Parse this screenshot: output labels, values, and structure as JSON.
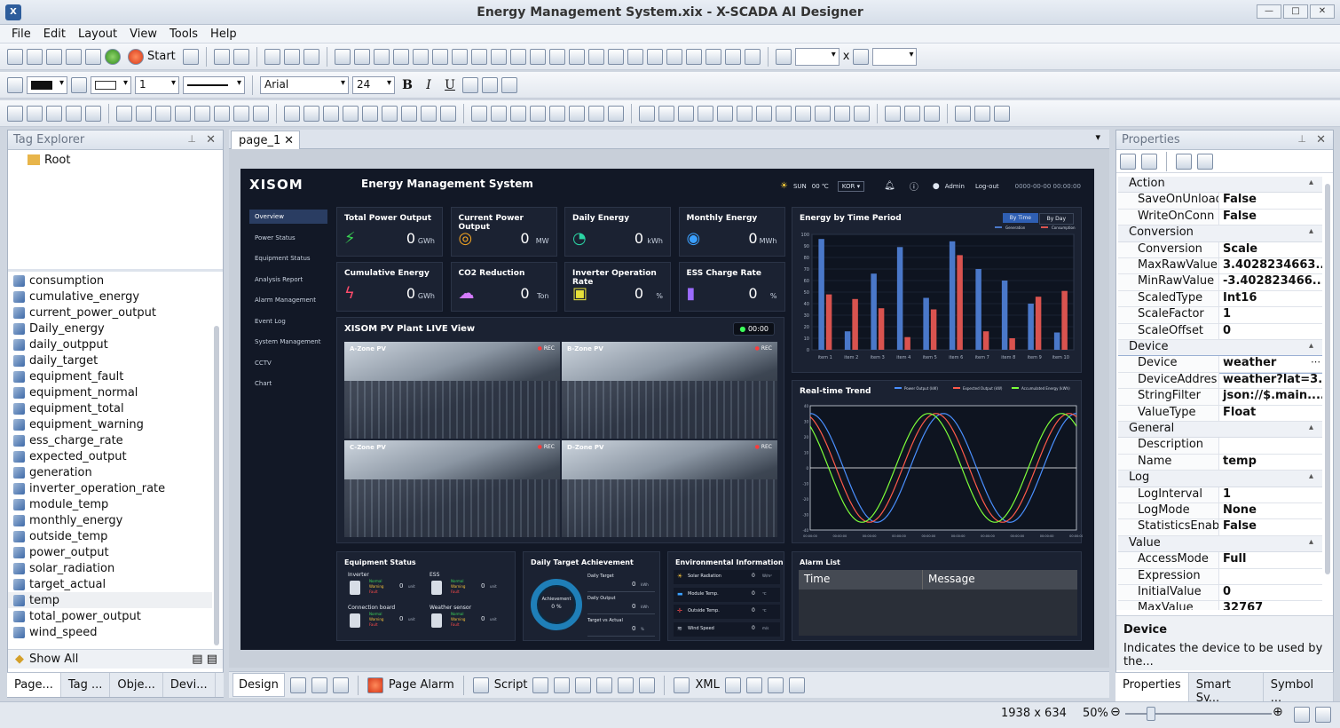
{
  "window": {
    "title": "Energy Management System.xix - X-SCADA AI Designer"
  },
  "menu": [
    "File",
    "Edit",
    "Layout",
    "View",
    "Tools",
    "Help"
  ],
  "toolbar": {
    "start_label": "Start",
    "font_name": "Arial",
    "font_size": "24",
    "line_width": "1",
    "size_sep": "x"
  },
  "tag_explorer": {
    "title": "Tag Explorer",
    "root": "Root",
    "tags": [
      "consumption",
      "cumulative_energy",
      "current_power_output",
      "Daily_energy",
      "daily_outpput",
      "daily_target",
      "equipment_fault",
      "equipment_normal",
      "equipment_total",
      "equipment_warning",
      "ess_charge_rate",
      "expected_output",
      "generation",
      "inverter_operation_rate",
      "module_temp",
      "monthly_energy",
      "outside_temp",
      "power_output",
      "solar_radiation",
      "target_actual",
      "temp",
      "total_power_output",
      "wind_speed"
    ],
    "selected": "temp",
    "show_all": "Show All",
    "tabs": [
      "Page...",
      "Tag ...",
      "Obje...",
      "Devi..."
    ]
  },
  "doc_tab": "page_1",
  "dashboard": {
    "logo": "XISOM",
    "title": "Energy Management System",
    "weather": "SUN",
    "temp": "00 ℃",
    "lang": "KOR",
    "user": "Admin",
    "logout": "Log-out",
    "datetime": "0000-00-00 00:00:00",
    "nav": [
      "Overview",
      "Power Status",
      "Equipment Status",
      "Analysis Report",
      "Alarm Management",
      "Event Log",
      "System Management",
      "CCTV",
      "Chart"
    ],
    "cards": [
      {
        "title": "Total Power Output",
        "value": "0",
        "unit": "GWh",
        "icon": "⚡",
        "color": "#39d353"
      },
      {
        "title": "Current Power Output",
        "value": "0",
        "unit": "MW",
        "icon": "◎",
        "color": "#f5a623"
      },
      {
        "title": "Daily Energy",
        "value": "0",
        "unit": "kWh",
        "icon": "◔",
        "color": "#2bd4a4"
      },
      {
        "title": "Monthly Energy",
        "value": "0",
        "unit": "MWh",
        "icon": "◉",
        "color": "#3aa0ff"
      },
      {
        "title": "Cumulative Energy",
        "value": "0",
        "unit": "GWh",
        "icon": "ϟ",
        "color": "#ff4b6b"
      },
      {
        "title": "CO2 Reduction",
        "value": "0",
        "unit": "Ton",
        "icon": "☁",
        "color": "#d57bff"
      },
      {
        "title": "Inverter Operation Rate",
        "value": "0",
        "unit": "%",
        "icon": "▣",
        "color": "#e6e03a"
      },
      {
        "title": "ESS Charge Rate",
        "value": "0",
        "unit": "%",
        "icon": "▮",
        "color": "#9b6bff"
      }
    ],
    "live": {
      "title": "XISOM PV Plant LIVE View",
      "timer": "00:00",
      "zones": [
        "A-Zone PV",
        "B-Zone PV",
        "C-Zone PV",
        "D-Zone PV"
      ],
      "rec": "REC"
    },
    "energy_chart": {
      "title": "Energy by Time Period",
      "btn1": "By Time",
      "btn2": "By Day",
      "legend": [
        "Generation",
        "Consumption"
      ]
    },
    "trend": {
      "title": "Real-time Trend",
      "legend": [
        "Power Output (kW)",
        "Expected Output (kW)",
        "Accumulated Energy (kWh)"
      ]
    },
    "equipment": {
      "title": "Equipment Status",
      "items": [
        "Inverter",
        "ESS",
        "Connection board",
        "Weather sensor"
      ],
      "states": [
        "Normal",
        "Warning",
        "Fault"
      ],
      "unit": "unit"
    },
    "daily_target": {
      "title": "Daily Target Achievement",
      "center": "Achievement",
      "pct": "0 %",
      "rows": [
        [
          "Daily Target",
          "0",
          "kWh"
        ],
        [
          "Daily Output",
          "0",
          "kWh"
        ],
        [
          "Target vs Actual",
          "0",
          "%"
        ]
      ]
    },
    "env": {
      "title": "Environmental Information",
      "rows": [
        [
          "Solar Radiation",
          "0",
          "W/m²"
        ],
        [
          "Module Temp.",
          "0",
          "℃"
        ],
        [
          "Outside Temp.",
          "0",
          "℃"
        ],
        [
          "Wind Speed",
          "0",
          "m/s"
        ]
      ]
    },
    "alarm": {
      "title": "Alarm List",
      "cols": [
        "Time",
        "Message"
      ]
    }
  },
  "chart_data": [
    {
      "type": "bar",
      "title": "Energy by Time Period",
      "categories": [
        "item 1",
        "item 2",
        "item 3",
        "item 4",
        "item 5",
        "item 6",
        "item 7",
        "item 8",
        "item 9",
        "item 10"
      ],
      "ylim": [
        0,
        100
      ],
      "yticks": [
        0,
        10,
        20,
        30,
        40,
        50,
        60,
        70,
        80,
        90,
        100
      ],
      "series": [
        {
          "name": "Generation",
          "color": "#4a78c9",
          "values": [
            96,
            16,
            66,
            89,
            45,
            94,
            70,
            60,
            40,
            15
          ]
        },
        {
          "name": "Consumption",
          "color": "#d9534f",
          "values": [
            48,
            44,
            36,
            11,
            35,
            82,
            16,
            10,
            46,
            51
          ]
        }
      ]
    },
    {
      "type": "line",
      "title": "Real-time Trend",
      "ylim": [
        -40,
        40
      ],
      "yticks": [
        40,
        30,
        20,
        10,
        0,
        -10,
        -20,
        -30,
        -40
      ],
      "xtick": "00:00:00",
      "series": [
        {
          "name": "Power Output (kW)",
          "color": "#4a90ff",
          "phase": 0
        },
        {
          "name": "Expected Output (kW)",
          "color": "#ff5a4a",
          "phase": 0.35
        },
        {
          "name": "Accumulated Energy (kWh)",
          "color": "#7dff3a",
          "phase": 0.7
        }
      ],
      "amplitude": 35
    }
  ],
  "properties": {
    "title": "Properties",
    "groups": [
      {
        "name": "Action",
        "rows": [
          [
            "SaveOnUnload",
            "False"
          ],
          [
            "WriteOnConn",
            "False"
          ]
        ]
      },
      {
        "name": "Conversion",
        "rows": [
          [
            "Conversion",
            "Scale"
          ],
          [
            "MaxRawValue",
            "3.4028234663..."
          ],
          [
            "MinRawValue",
            "-3.402823466..."
          ],
          [
            "ScaledType",
            "Int16"
          ],
          [
            "ScaleFactor",
            "1"
          ],
          [
            "ScaleOffset",
            "0"
          ]
        ]
      },
      {
        "name": "Device",
        "rows": [
          [
            "Device",
            "weather"
          ],
          [
            "DeviceAddres",
            "weather?lat=3..."
          ],
          [
            "StringFilter",
            "json://$.main...."
          ],
          [
            "ValueType",
            "Float"
          ]
        ]
      },
      {
        "name": "General",
        "rows": [
          [
            "Description",
            ""
          ],
          [
            "Name",
            "temp"
          ]
        ]
      },
      {
        "name": "Log",
        "rows": [
          [
            "LogInterval",
            "1"
          ],
          [
            "LogMode",
            "None"
          ],
          [
            "StatisticsEnab",
            "False"
          ]
        ]
      },
      {
        "name": "Value",
        "rows": [
          [
            "AccessMode",
            "Full"
          ],
          [
            "Expression",
            ""
          ],
          [
            "InitialValue",
            "0"
          ],
          [
            "MaxValue",
            "32767"
          ]
        ]
      }
    ],
    "desc_title": "Device",
    "desc_text": "Indicates the device to be used by the...",
    "tabs": [
      "Properties",
      "Smart Sy...",
      "Symbol ..."
    ]
  },
  "bottom_tabs": [
    "Design",
    "Page Alarm",
    "Script",
    "XML"
  ],
  "status": {
    "size": "1938 x 634",
    "zoom": "50%"
  }
}
